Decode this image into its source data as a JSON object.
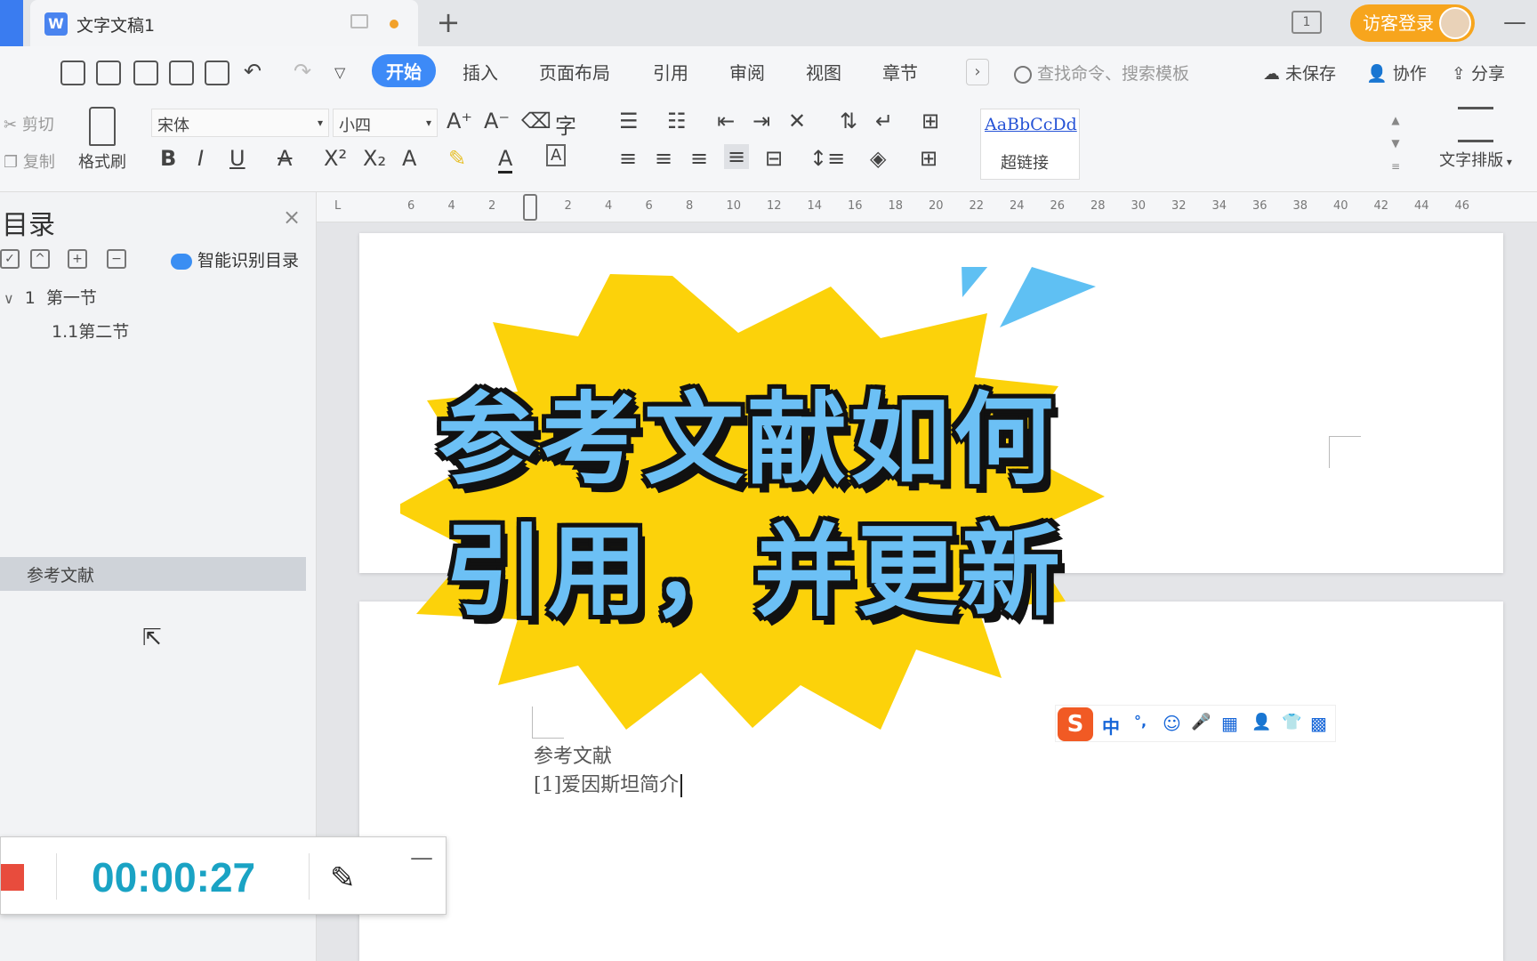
{
  "titlebar": {
    "doc_title": "文字文稿1",
    "new_tab": "+",
    "pages_indicator": "1",
    "login_label": "访客登录",
    "minimize": "—"
  },
  "menubar": {
    "tabs": [
      {
        "label": "开始",
        "active": true
      },
      {
        "label": "插入"
      },
      {
        "label": "页面布局"
      },
      {
        "label": "引用"
      },
      {
        "label": "审阅"
      },
      {
        "label": "视图"
      },
      {
        "label": "章节"
      }
    ],
    "more": "›",
    "search_placeholder": "查找命令、搜索模板",
    "unsaved": "未保存",
    "collaborate": "协作",
    "share": "分享"
  },
  "ribbon": {
    "cut": "剪切",
    "copy": "复制",
    "format_painter": "格式刷",
    "font_name": "宋体",
    "font_size": "小四",
    "style_sample": "AaBbCcDd",
    "style_name": "超链接",
    "text_layout": "文字排版"
  },
  "toc": {
    "title": "目录",
    "close": "×",
    "smart_toc": "智能识别目录",
    "items": [
      {
        "number": "1",
        "label": "第一节"
      },
      {
        "number": "1.1",
        "label": "第二节"
      },
      {
        "label": "参考文献"
      }
    ]
  },
  "ruler": {
    "ticks": [
      "6",
      "4",
      "2",
      "2",
      "4",
      "6",
      "8",
      "10",
      "12",
      "14",
      "16",
      "18",
      "20",
      "22",
      "24",
      "26",
      "28",
      "30",
      "32",
      "34",
      "36",
      "38",
      "40",
      "42",
      "44",
      "46"
    ]
  },
  "document": {
    "heading": "参考文献",
    "reference": "[1]爱因斯坦简介"
  },
  "ime": {
    "items": [
      "中",
      "°,",
      "☺",
      "🎤",
      "▦",
      "👤",
      "👕",
      "▩"
    ]
  },
  "overlay": {
    "line1": "参考文献如何",
    "line2": "引用，并更新",
    "burst_color": "#fcd20a",
    "accent_color": "#5fc0f3"
  },
  "recorder": {
    "time": "00:00:27",
    "minimize": "—"
  },
  "colors": {
    "active_tab": "#3d8af7",
    "login": "#f7a51d",
    "timer": "#1aa3c4"
  }
}
